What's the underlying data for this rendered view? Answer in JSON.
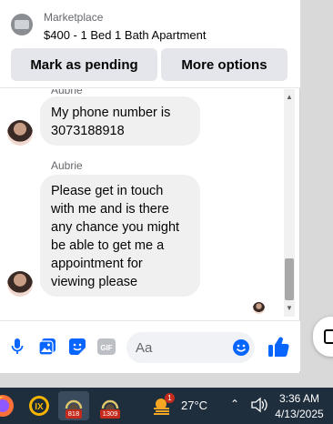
{
  "listing": {
    "source": "Marketplace",
    "title": "$400 - 1 Bed 1 Bath Apartment",
    "mark_pending_label": "Mark as pending",
    "more_options_label": "More options"
  },
  "messages": {
    "clipped_sender": "Aubrie",
    "sender_name": "Aubrie",
    "items": [
      {
        "text": "My phone number is 3073188918"
      },
      {
        "text": "Please get in touch with me and is there any chance you might be able to get me a appointment for viewing please"
      }
    ]
  },
  "composer": {
    "placeholder": "Aa",
    "icons": [
      "microphone-icon",
      "photo-icon",
      "sticker-icon",
      "gif-icon",
      "emoji-icon",
      "thumbs-up-icon"
    ],
    "gif_label": "GIF"
  },
  "taskbar": {
    "apps": [
      {
        "icon": "firefox-icon"
      },
      {
        "icon": "ix-app-icon"
      },
      {
        "icon": "gimp-icon",
        "badge": "818"
      },
      {
        "icon": "gimp-icon",
        "badge": "1309"
      }
    ],
    "weather_badge": "1",
    "temperature": "27°C",
    "time": "3:36 AM",
    "date": "4/13/2025"
  },
  "colors": {
    "accent": "#0866ff",
    "bubble": "#f0f0f0",
    "button": "#e4e6eb",
    "taskbar": "#1f2e3d"
  }
}
